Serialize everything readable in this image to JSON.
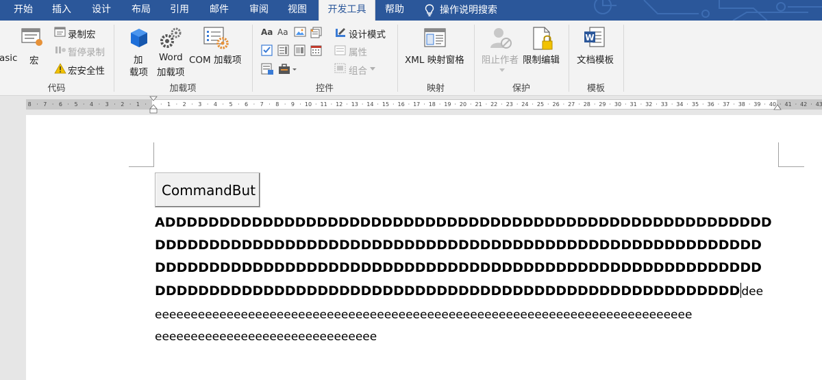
{
  "tabs": [
    {
      "label": "开始",
      "active": false
    },
    {
      "label": "插入",
      "active": false
    },
    {
      "label": "设计",
      "active": false
    },
    {
      "label": "布局",
      "active": false
    },
    {
      "label": "引用",
      "active": false
    },
    {
      "label": "邮件",
      "active": false
    },
    {
      "label": "审阅",
      "active": false
    },
    {
      "label": "视图",
      "active": false
    },
    {
      "label": "开发工具",
      "active": true
    },
    {
      "label": "帮助",
      "active": false
    }
  ],
  "search": {
    "label": "操作说明搜索",
    "icon": "lightbulb-icon"
  },
  "ribbon": {
    "code": {
      "visual_basic_label": "asic",
      "macros_label": "宏",
      "record_macro": "录制宏",
      "pause_recording": "暂停录制",
      "macro_security": "宏安全性",
      "group_label": "代码"
    },
    "addins": {
      "addins_line1": "加",
      "addins_line2": "载项",
      "word_line1": "Word",
      "word_line2": "加载项",
      "com_label": "COM 加载项",
      "group_label": "加载项"
    },
    "controls": {
      "design_mode": "设计模式",
      "properties": "属性",
      "group": "组合",
      "group_label": "控件"
    },
    "mapping": {
      "xml_pane": "XML 映射窗格",
      "group_label": "映射"
    },
    "protect": {
      "block_authors": "阻止作者",
      "restrict_editing": "限制编辑",
      "group_label": "保护"
    },
    "templates": {
      "document_template": "文档模板",
      "group_label": "模板"
    }
  },
  "ruler": {
    "left_numbers": [
      "8",
      "7",
      "6",
      "5",
      "4",
      "3",
      "2",
      "1"
    ],
    "right_numbers": [
      "1",
      "2",
      "3",
      "4",
      "5",
      "6",
      "7",
      "8",
      "9",
      "10",
      "11",
      "12",
      "13",
      "14",
      "15",
      "16",
      "17",
      "18",
      "19",
      "20",
      "21",
      "22",
      "23",
      "24",
      "25",
      "26",
      "27",
      "28",
      "29",
      "30",
      "31",
      "32",
      "33",
      "34",
      "35",
      "36",
      "37",
      "38",
      "39",
      "40",
      "41",
      "42",
      "43"
    ]
  },
  "document": {
    "command_button": "CommandBut",
    "bold_lines": [
      "ADDDDDDDDDDDDDDDDDDDDDDDDDDDDDDDDDDDDDDDDDDDDDDDDDDDDDDDD",
      "DDDDDDDDDDDDDDDDDDDDDDDDDDDDDDDDDDDDDDDDDDDDDDDDDDDDDDDD",
      "DDDDDDDDDDDDDDDDDDDDDDDDDDDDDDDDDDDDDDDDDDDDDDDDDDDDDDDD",
      "DDDDDDDDDDDDDDDDDDDDDDDDDDDDDDDDDDDDDDDDDDDDDDDDDDDDDD"
    ],
    "line4_tail": "dee",
    "normal_lines": [
      "eeeeeeeeeeeeeeeeeeeeeeeeeeeeeeeeeeeeeeeeeeeeeeeeeeeeeeeeeeeeeeeeeeeeeeeeeee",
      "eeeeeeeeeeeeeeeeeeeeeeeeeeeeeee"
    ]
  },
  "colors": {
    "tab_bar": "#2b579a",
    "ribbon_bg": "#f3f3f3",
    "page_bg": "#ffffff",
    "workspace_bg": "#e6e6e6"
  }
}
